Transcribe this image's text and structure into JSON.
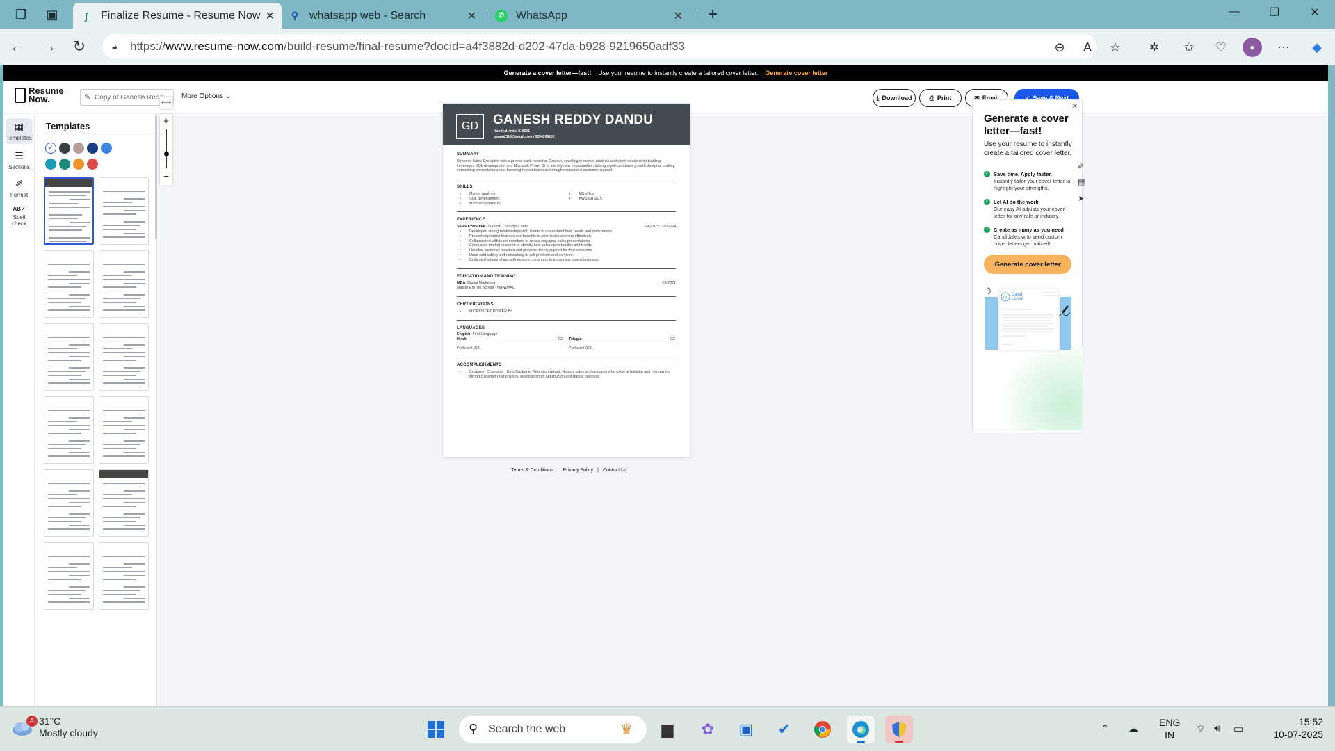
{
  "browser": {
    "tabs": [
      {
        "title": "Finalize Resume - Resume Now",
        "active": true
      },
      {
        "title": "whatsapp web - Search",
        "active": false
      },
      {
        "title": "WhatsApp",
        "active": false
      }
    ],
    "url_prefix": "https://",
    "url_domain": "www.resume-now.com",
    "url_path": "/build-resume/final-resume?docid=a4f3882d-d202-47da-b928-9219650adf33"
  },
  "promo": {
    "bold": "Generate a cover letter—fast!",
    "text": "Use your resume to instantly create a tailored cover letter.",
    "link": "Generate cover letter"
  },
  "header": {
    "logo_line1": "Resume",
    "logo_line2": "Now.",
    "doc_name": "Copy of Ganesh Redd",
    "more_options": "More Options",
    "download": "Download",
    "print": "Print",
    "email": "Email",
    "save_next": "Save & Next"
  },
  "rail": {
    "items": [
      {
        "label": "Templates",
        "icon": "grid-icon"
      },
      {
        "label": "Sections",
        "icon": "list-icon"
      },
      {
        "label": "Format",
        "icon": "brush-icon"
      },
      {
        "label": "Spell check",
        "icon": "spellcheck-icon"
      }
    ]
  },
  "templates": {
    "title": "Templates",
    "colors": [
      "#ffffff",
      "#3a3f44",
      "#b59c99",
      "#1e3f86",
      "#3b86e0",
      "#1b9bb4",
      "#1b8a76",
      "#f0932b",
      "#d94a4a"
    ]
  },
  "resume": {
    "monogram": "GD",
    "name": "GANESH REDDY DANDU",
    "location": "Nandyal, India 518501",
    "contact": "gannu2114@gmail.com  /  9390299160",
    "summary_title": "SUMMARY",
    "summary": "Dynamic Sales Executive with a proven track record at Ganesh, excelling in market analysis and client relationship building. Leveraged SQL development and Microsoft Power BI to identify new opportunities, driving significant sales growth. Adept at crafting compelling presentations and fostering repeat business through exceptional customer support.",
    "skills_title": "SKILLS",
    "skills_left": [
      "Market analysis",
      "SQL development",
      "Microsoft power BI"
    ],
    "skills_right": [
      "MS office",
      "AWS BASICS"
    ],
    "experience_title": "EXPERIENCE",
    "job_title": "Sales Executive",
    "job_company": "/  Ganesh - Nandyal, India",
    "job_dates": "04/2023 - 02/2024",
    "job_bullets": [
      "Developed strong relationships with clients to understand their needs and preferences.",
      "Presented product features and benefits to potential customers effectively.",
      "Collaborated with team members to create engaging sales presentations.",
      "Conducted market research to identify new sales opportunities and trends.",
      "Handled customer inquiries and provided timely support for their concerns.",
      "Used cold calling and networking to sell products and services.",
      "Cultivated relationships with existing customers to encourage repeat business."
    ],
    "education_title": "EDUCATION AND TRAINING",
    "degree": "MBA",
    "degree_field": ": Digital Marketing",
    "edu_date": "05/2021",
    "school": "Master Em Tm School - NANDYAL",
    "cert_title": "CERTIFICATIONS",
    "certs": [
      "MICROSOFT POWER BI"
    ],
    "lang_title": "LANGUAGES",
    "first_lang_label": "English",
    "first_lang_value": ": First Language",
    "languages": [
      {
        "name": "Hindi:",
        "level": "C2",
        "desc": "Proficient (C2)"
      },
      {
        "name": "Telugu:",
        "level": "C2",
        "desc": "Proficient (C2)"
      }
    ],
    "acc_title": "ACCOMPLISHMENTS",
    "accomplishments": [
      "Customer Champion / Best Customer Retention Award: Honors sales professionals who excel at building and maintaining strong customer relationships, leading to high satisfaction and repeat business."
    ]
  },
  "footer": {
    "terms": "Terms & Conditions",
    "privacy": "Privacy Policy",
    "contact": "Contact Us"
  },
  "cover_panel": {
    "title": "Generate a cover letter—fast!",
    "lead": "Use your resume to instantly create a tailored cover letter.",
    "features": [
      {
        "title": "Save time. Apply faster.",
        "text": "Instantly tailor your cover letter to highlight your strengths."
      },
      {
        "title": "Let AI do the work",
        "text": "Our easy AI adjusts your cover letter for any role or industry."
      },
      {
        "title": "Create as many as you need",
        "text": "Candidates who send custom cover letters get noticed!"
      }
    ],
    "button": "Generate cover letter",
    "sample_name_1": "David",
    "sample_name_2": "Lopez"
  },
  "taskbar": {
    "weather_badge": "4",
    "temp": "31°C",
    "condition": "Mostly cloudy",
    "search_placeholder": "Search the web",
    "lang_1": "ENG",
    "lang_2": "IN",
    "time": "15:52",
    "date": "10-07-2025"
  }
}
